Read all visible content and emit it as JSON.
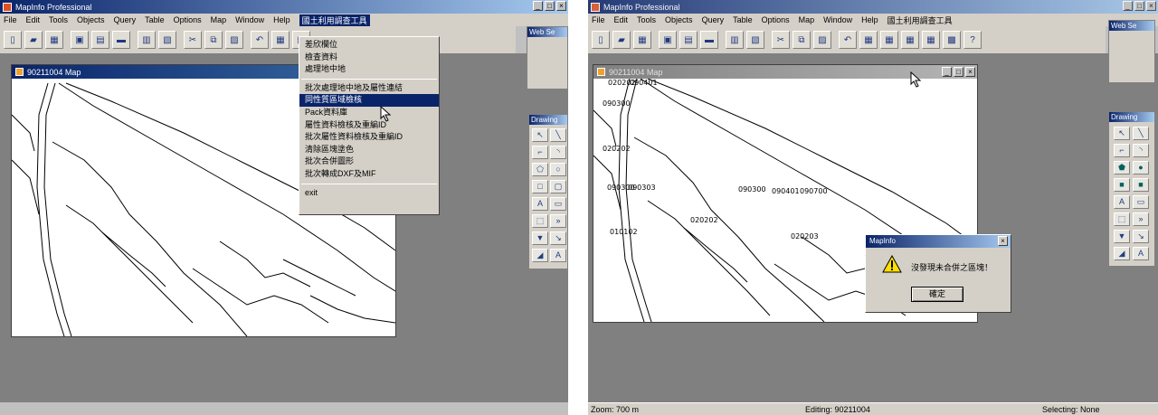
{
  "left": {
    "app_title": "MapInfo Professional",
    "menus": [
      "File",
      "Edit",
      "Tools",
      "Objects",
      "Query",
      "Table",
      "Options",
      "Map",
      "Window",
      "Help",
      "國土利用調查工具"
    ],
    "active_menu_index": 10,
    "map_window_title": "90211004 Map",
    "dropdown": {
      "group1": [
        "差欣欄位",
        "檢查資料",
        "處理地中地"
      ],
      "group2": [
        "批次處理地中地及屬性連結",
        "同性質區域檢核",
        "Pack資料庫",
        "屬性資料檢核及重編ID",
        "批次屬性資料檢核及重編ID",
        "清除區塊塗色",
        "批次合併圖形",
        "批次轉成DXF及MIF"
      ],
      "group3": [
        "exit"
      ],
      "highlighted": "同性質區域檢核"
    },
    "web_panel_title": "Web Se",
    "drawing_panel_title": "Drawing"
  },
  "right": {
    "app_title": "MapInfo Professional",
    "menus": [
      "File",
      "Edit",
      "Tools",
      "Objects",
      "Query",
      "Table",
      "Options",
      "Map",
      "Window",
      "Help",
      "國土利用調查工具"
    ],
    "map_window_title": "90211004 Map",
    "web_panel_title": "Web Se",
    "drawing_panel_title": "Drawing",
    "map_labels": [
      "020202",
      "090401",
      "090300",
      "020202",
      "090300",
      "090303",
      "090300",
      "090401",
      "090700",
      "020202",
      "010102",
      "020203"
    ],
    "dialog": {
      "title": "MapInfo",
      "message": "沒發現未合併之區塊！",
      "ok_label": "確定",
      "close_glyph": "×"
    },
    "status": {
      "zoom": "Zoom: 700 m",
      "editing": "Editing:  90211004",
      "selecting": "Selecting: None"
    }
  },
  "icons": {
    "minimize": "_",
    "maximize": "□",
    "close": "×"
  }
}
